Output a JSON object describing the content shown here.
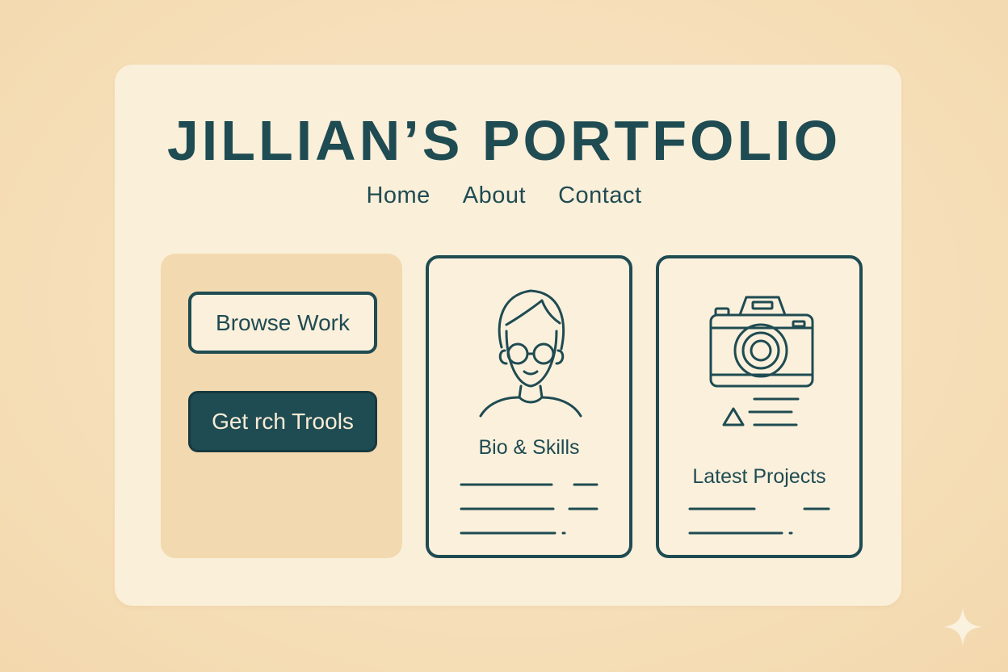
{
  "site": {
    "title": "JILLIAN’S PORTFOLIO"
  },
  "nav": {
    "items": [
      {
        "label": "Home"
      },
      {
        "label": "About"
      },
      {
        "label": "Contact"
      }
    ]
  },
  "sidebar": {
    "buttons": [
      {
        "label": "Browse Work",
        "style": "outline"
      },
      {
        "label": "Get rch Trools",
        "style": "solid"
      }
    ]
  },
  "cards": [
    {
      "label": "Bio & Skills",
      "icon": "person-with-glasses-icon"
    },
    {
      "label": "Latest Projects",
      "icon": "camera-icon"
    }
  ],
  "colors": {
    "background": "#f6dfba",
    "panel": "#faefd9",
    "accent": "#1f4b52",
    "sidebar": "#f3d9b0"
  }
}
